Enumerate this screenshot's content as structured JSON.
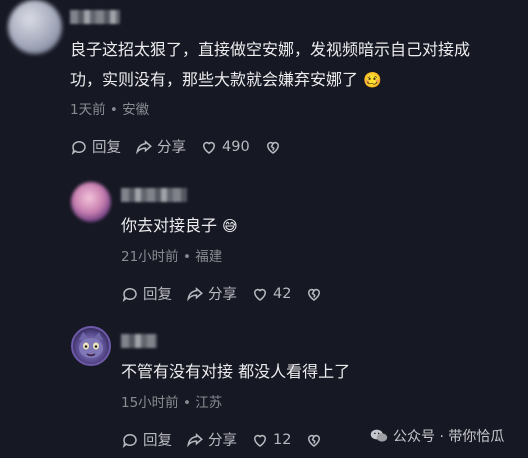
{
  "comments": [
    {
      "text_line1": "良子这招太狠了，直接做空安娜，发视频暗示自己对接成",
      "text_line2": "功，实则没有，那些大款就会嫌弃安娜了",
      "emoji": "🥴",
      "time": "1天前",
      "location": "安徽",
      "reply_label": "回复",
      "share_label": "分享",
      "likes": "490"
    },
    {
      "text_line1": "你去对接良子",
      "emoji": "😅",
      "time": "21小时前",
      "location": "福建",
      "reply_label": "回复",
      "share_label": "分享",
      "likes": "42"
    },
    {
      "text_line1": "不管有没有对接 都没人看得上了",
      "time": "15小时前",
      "location": "江苏",
      "reply_label": "回复",
      "share_label": "分享",
      "likes": "12"
    }
  ],
  "separator": "•",
  "watermark": "公众号 · 带你恰瓜",
  "colors": {
    "background": "#161823",
    "text": "#ececee",
    "meta": "#8a8b91",
    "actions": "#b9bac0"
  }
}
